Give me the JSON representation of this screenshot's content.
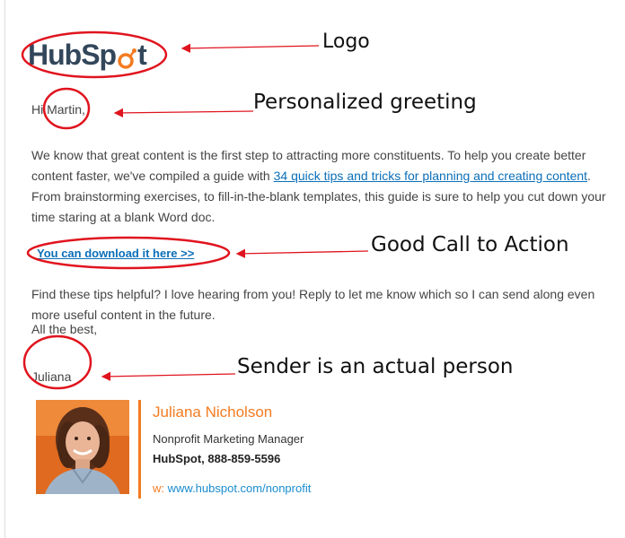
{
  "email": {
    "logo_text_left": "HubSp",
    "logo_text_right": "t",
    "greeting": "Hi Martin,",
    "paragraph1_before": "We know that great content is the first step to attracting more constituents. To help you create better content faster, we've compiled a guide with ",
    "paragraph1_link": "34 quick tips and tricks for planning and creating content",
    "paragraph1_after": ". From brainstorming exercises, to fill-in-the-blank templates, this guide is sure to help you cut down your time staring at a blank Word doc.",
    "cta_link": "You can download it here >>",
    "paragraph2": "Find these tips helpful? I love hearing from you! Reply to let me know which so I can send along even more useful content in the future.",
    "closing": "All the best,",
    "sender_first_name": "Juliana"
  },
  "signature": {
    "name": "Juliana Nicholson",
    "title": "Nonprofit Marketing Manager",
    "company_phone": "HubSpot, 888-859-5596",
    "web_prefix": "w:",
    "web_url": "www.hubspot.com/nonprofit"
  },
  "annotations": {
    "logo": "Logo",
    "greeting": "Personalized greeting",
    "cta": "Good Call to Action",
    "sender": "Sender is an actual person"
  },
  "colors": {
    "hubspot_navy": "#33475b",
    "hubspot_orange": "#f47b20",
    "link_blue": "#0b6fb8",
    "annotation_red": "#e0141e"
  },
  "icons": {
    "sprocket": "hubspot-sprocket-icon"
  }
}
